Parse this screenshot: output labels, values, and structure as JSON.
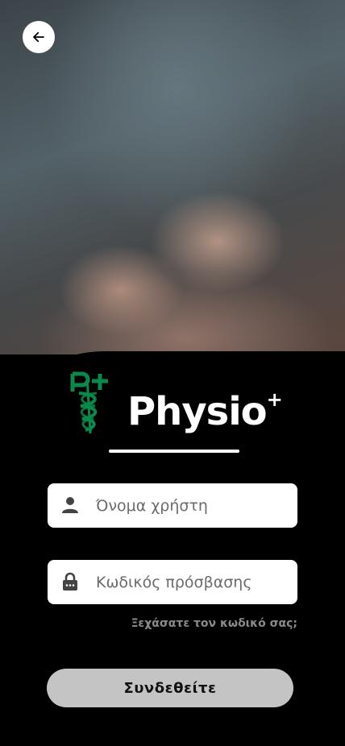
{
  "header": {
    "back_icon": "arrow-left-icon"
  },
  "brand": {
    "name": "Physio",
    "superscript": "+",
    "emblem_icon": "caduceus-logo-icon",
    "accent": "#0a8a4a"
  },
  "form": {
    "username": {
      "placeholder": "Όνομα χρήστη",
      "value": "",
      "icon": "user-icon"
    },
    "password": {
      "placeholder": "Κωδικός πρόσβασης",
      "value": "",
      "icon": "lock-icon"
    },
    "forgot_label": "Ξεχάσατε τον κωδικό σας;",
    "submit_label": "Συνδεθείτε"
  },
  "colors": {
    "background": "#000000",
    "button": "#c4c4c4",
    "field": "#ffffff"
  }
}
